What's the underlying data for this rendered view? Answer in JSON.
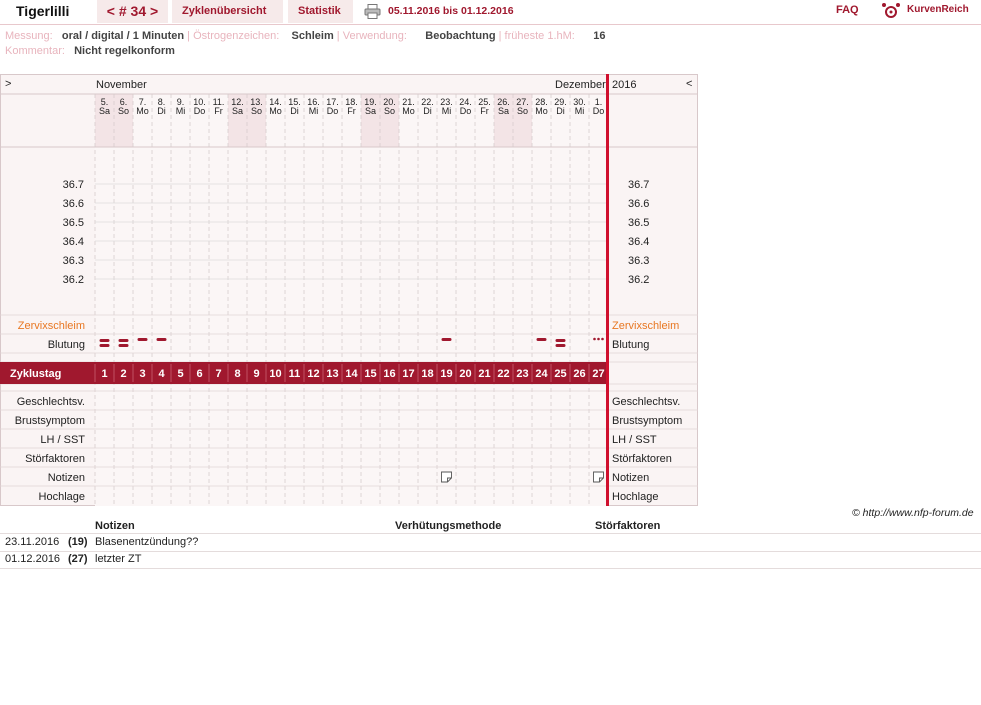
{
  "header": {
    "user": "Tigerlilli",
    "cycle_nav": "< # 34 >",
    "tabs": [
      "Zyklenübersicht",
      "Statistik"
    ],
    "date_range": "05.11.2016 bis 01.12.2016",
    "faq": "FAQ",
    "brand": "KurvenReich"
  },
  "meta": {
    "messung_label": "Messung:",
    "messung_value": "oral / digital / 1 Minuten",
    "oestrogen_label": "Östrogenzeichen:",
    "oestrogen_value": "Schleim",
    "verwendung_label": "Verwendung:",
    "verwendung_value": "Beobachtung",
    "hm_label": "früheste 1.hM:",
    "hm_value": "16",
    "kommentar_label": "Kommentar:",
    "kommentar_value": "Nicht regelkonform"
  },
  "chart": {
    "nav_prev": ">",
    "nav_next": "<",
    "month1": "November",
    "month2": "Dezember",
    "year": "2016",
    "dates": [
      "5.",
      "6.",
      "7.",
      "8.",
      "9.",
      "10.",
      "11.",
      "12.",
      "13.",
      "14.",
      "15.",
      "16.",
      "17.",
      "18.",
      "19.",
      "20.",
      "21.",
      "22.",
      "23.",
      "24.",
      "25.",
      "26.",
      "27.",
      "28.",
      "29.",
      "30.",
      "1."
    ],
    "weekdays": [
      "Sa",
      "So",
      "Mo",
      "Di",
      "Mi",
      "Do",
      "Fr",
      "Sa",
      "So",
      "Mo",
      "Di",
      "Mi",
      "Do",
      "Fr",
      "Sa",
      "So",
      "Mo",
      "Di",
      "Mi",
      "Do",
      "Fr",
      "Sa",
      "So",
      "Mo",
      "Di",
      "Mi",
      "Do"
    ],
    "weekend_flags": [
      1,
      1,
      0,
      0,
      0,
      0,
      0,
      1,
      1,
      0,
      0,
      0,
      0,
      0,
      1,
      1,
      0,
      0,
      0,
      0,
      0,
      1,
      1,
      0,
      0,
      0,
      0
    ],
    "temp_ticks": [
      "36.7",
      "36.6",
      "36.5",
      "36.4",
      "36.3",
      "36.2"
    ],
    "row_zervix": "Zervixschleim",
    "row_blutung": "Blutung",
    "row_zyklustag": "Zyklustag",
    "cycle_days": [
      "1",
      "2",
      "3",
      "4",
      "5",
      "6",
      "7",
      "8",
      "9",
      "10",
      "11",
      "12",
      "13",
      "14",
      "15",
      "16",
      "17",
      "18",
      "19",
      "20",
      "21",
      "22",
      "23",
      "24",
      "25",
      "26",
      "27"
    ],
    "bleeding": [
      2,
      2,
      1,
      1,
      0,
      0,
      0,
      0,
      0,
      0,
      0,
      0,
      0,
      0,
      0,
      0,
      0,
      0,
      1,
      0,
      0,
      0,
      0,
      1,
      2,
      0,
      3
    ],
    "lower_rows": [
      "Geschlechtsv.",
      "Brustsymptom",
      "LH / SST",
      "Störfaktoren",
      "Notizen",
      "Hochlage"
    ],
    "note_days": [
      19,
      27
    ],
    "colors": {
      "accent": "#a0182e",
      "zervix": "#e87722",
      "weekend": "#f3e4e6"
    }
  },
  "copyright": "© http://www.nfp-forum.de",
  "notes": {
    "headers": [
      "Notizen",
      "Verhütungsmethode",
      "Störfaktoren"
    ],
    "rows": [
      {
        "date": "23.11.2016",
        "day": "(19)",
        "text": "Blasenentzündung??"
      },
      {
        "date": "01.12.2016",
        "day": "(27)",
        "text": "letzter ZT"
      }
    ]
  }
}
